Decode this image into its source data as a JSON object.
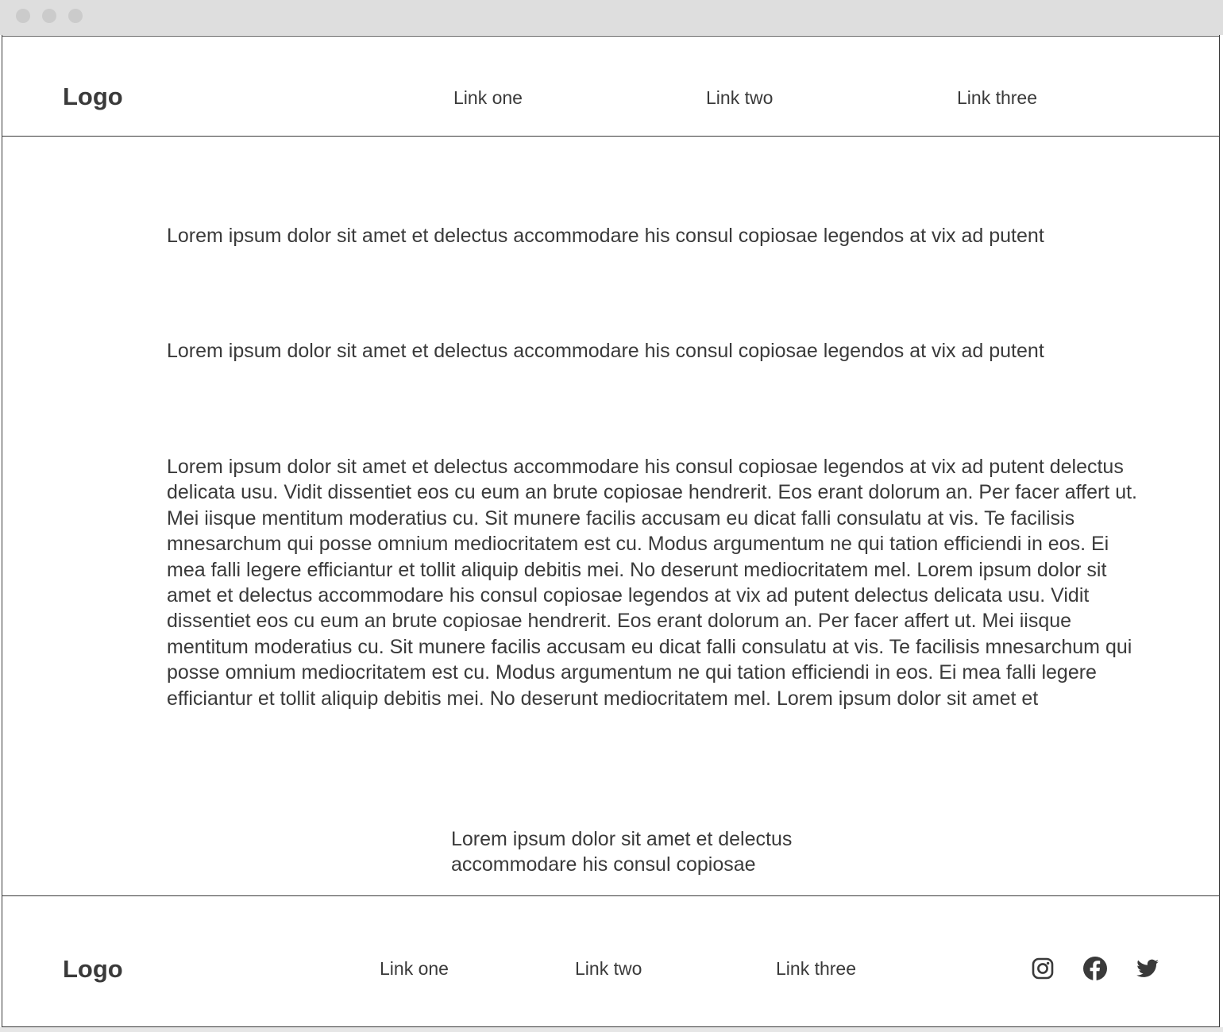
{
  "header": {
    "logo": "Logo",
    "links": [
      "Link one",
      "Link two",
      "Link three"
    ]
  },
  "main": {
    "paragraphs": [
      "Lorem ipsum dolor sit amet et delectus accommodare his consul copiosae legendos at vix ad putent",
      "Lorem ipsum dolor sit amet et delectus accommodare his consul copiosae legendos at vix ad putent",
      "Lorem ipsum dolor sit amet et delectus accommodare his consul copiosae legendos at vix ad putent delectus delicata usu. Vidit dissentiet eos cu eum an brute copiosae hendrerit. Eos erant dolorum an. Per facer affert ut. Mei iisque mentitum moderatius cu. Sit munere facilis accusam eu dicat falli consulatu at vis. Te facilisis mnesarchum qui posse omnium mediocritatem est cu. Modus argumentum ne qui tation efficiendi in eos. Ei mea falli legere efficiantur et tollit aliquip debitis mei. No deserunt mediocritatem mel. Lorem ipsum dolor sit amet et delectus accommodare his consul copiosae legendos at vix ad putent delectus delicata usu. Vidit dissentiet eos cu eum an brute copiosae hendrerit. Eos erant dolorum an. Per facer affert ut. Mei iisque mentitum moderatius cu. Sit munere facilis accusam eu dicat falli consulatu at vis. Te facilisis mnesarchum qui posse omnium mediocritatem est cu. Modus argumentum ne qui tation efficiendi in eos. Ei mea falli legere efficiantur et tollit aliquip debitis mei. No deserunt mediocritatem mel. Lorem ipsum dolor sit amet et",
      "Lorem ipsum dolor sit amet et delectus accommodare his consul copiosae"
    ]
  },
  "footer": {
    "logo": "Logo",
    "links": [
      "Link one",
      "Link two",
      "Link three"
    ],
    "social_icons": [
      "instagram-icon",
      "facebook-icon",
      "twitter-icon"
    ]
  },
  "colors": {
    "text": "#3a3a3a",
    "border": "#3a3a3a",
    "titlebar": "#dedede",
    "window_dot": "#cbcbcb",
    "background": "#ffffff"
  }
}
